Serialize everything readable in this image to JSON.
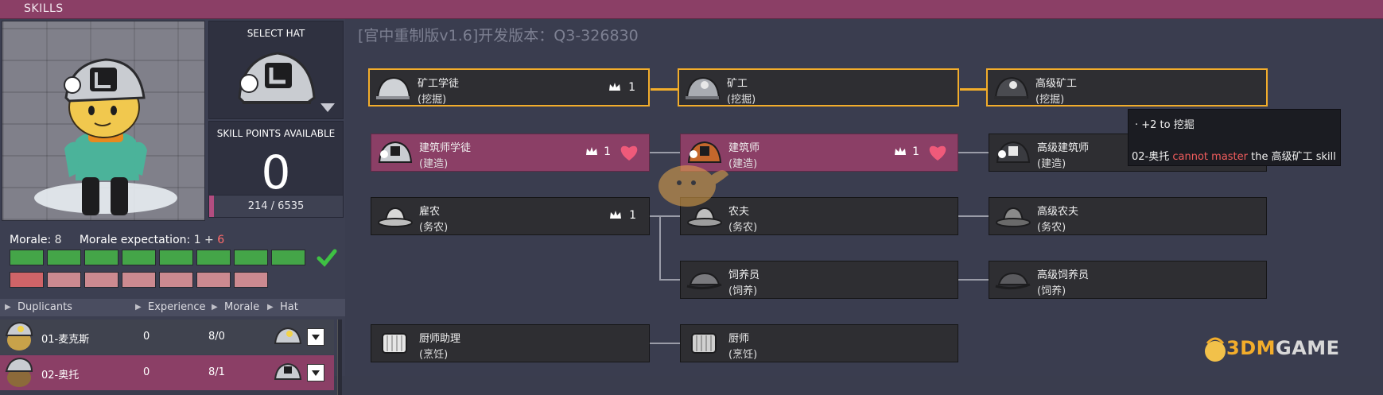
{
  "window": {
    "title": "SKILLS"
  },
  "hat_panel": {
    "label": "SELECT HAT",
    "hat_icon": "hard-hat-icon"
  },
  "skill_points": {
    "label": "SKILL POINTS AVAILABLE",
    "value": "0",
    "progress_text": "214 / 6535",
    "progress_fraction": 0.033
  },
  "morale": {
    "morale_label": "Morale:",
    "morale_value": "8",
    "expectation_label": "Morale expectation:",
    "expectation_value": "1 +",
    "expectation_extra": "6",
    "morale_bars": 8,
    "expectation_bars": 7,
    "status_icon": "checkmark-icon",
    "colors": {
      "morale_bar": "#44a548",
      "expectation_bar": "#cc8a90",
      "accent_red": "#ff6b6b"
    }
  },
  "dupe_table": {
    "headers": [
      "Duplicants",
      "Experience",
      "Morale",
      "Hat"
    ],
    "rows": [
      {
        "name": "01-麦克斯",
        "experience": "0",
        "morale": "8/0"
      },
      {
        "name": "02-奥托",
        "experience": "0",
        "morale": "8/1"
      }
    ]
  },
  "version_text": "[官中重制版v1.6]开发版本：Q3-326830",
  "skills": [
    {
      "id": "mining1",
      "name": "矿工学徒",
      "category": "(挖掘)",
      "crowns": "1"
    },
    {
      "id": "mining2",
      "name": "矿工",
      "category": "(挖掘)"
    },
    {
      "id": "mining3",
      "name": "高级矿工",
      "category": "(挖掘)"
    },
    {
      "id": "build1",
      "name": "建筑师学徒",
      "category": "(建造)",
      "crowns": "1"
    },
    {
      "id": "build2",
      "name": "建筑师",
      "category": "(建造)",
      "crowns": "1"
    },
    {
      "id": "build3",
      "name": "高级建筑师",
      "category": "(建造)"
    },
    {
      "id": "farm1",
      "name": "雇农",
      "category": "(务农)",
      "crowns": "1"
    },
    {
      "id": "farm2",
      "name": "农夫",
      "category": "(务农)"
    },
    {
      "id": "farm3",
      "name": "高级农夫",
      "category": "(务农)"
    },
    {
      "id": "ranch2",
      "name": "饲养员",
      "category": "(饲养)"
    },
    {
      "id": "ranch3",
      "name": "高级饲养员",
      "category": "(饲养)"
    },
    {
      "id": "cook1",
      "name": "厨师助理",
      "category": "(烹饪)"
    },
    {
      "id": "cook2",
      "name": "厨师",
      "category": "(烹饪)"
    }
  ],
  "tooltip": {
    "line1": "·  +2 to 挖掘",
    "line2_prefix": "02-奥托 ",
    "line2_red": "cannot master",
    "line2_suffix": " the 高级矿工 skill"
  },
  "colors": {
    "accent_pink": "#8b3f66",
    "gold": "#f2ad2b",
    "node_bg": "#2e2e32",
    "heart": "#ef5a7a"
  },
  "watermark": {
    "prefix": "3DM",
    "suffix": "GAME"
  }
}
